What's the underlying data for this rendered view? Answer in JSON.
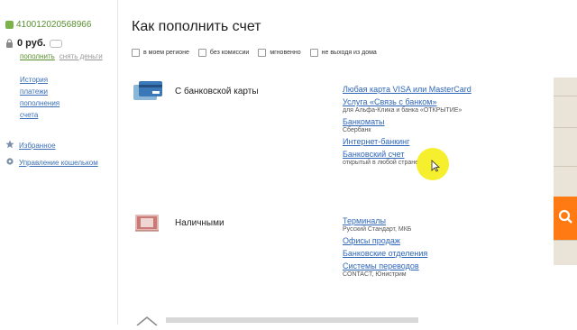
{
  "account": {
    "number": "410012020568966",
    "balance": "0 руб.",
    "top_up": "пополнить",
    "withdraw": "снять деньги"
  },
  "nav": {
    "history": "История",
    "payments": "платежи",
    "topups": "пополнения",
    "invoices": "счета",
    "favorites": "Избранное",
    "wallet": "Управление кошельком"
  },
  "main": {
    "title": "Как пополнить счет",
    "filters": [
      "в моем регионе",
      "без комиссии",
      "мгновенно",
      "не выходя из дома"
    ]
  },
  "methods": {
    "card": {
      "label": "С банковской карты",
      "options": [
        {
          "link": "Любая карта VISA или MasterCard",
          "sub": ""
        },
        {
          "link": "Услуга «Связь с банком»",
          "sub": "для Альфа-Клика и банка «ОТКРЫТИЕ»"
        },
        {
          "link": "Банкоматы",
          "sub": "Сбербанк"
        },
        {
          "link": "Интернет-банкинг",
          "sub": ""
        },
        {
          "link": "Банковский счет",
          "sub": "открытый в любой стране"
        }
      ]
    },
    "cash": {
      "label": "Наличными",
      "options": [
        {
          "link": "Терминалы",
          "sub": "Русский Стандарт, МКБ"
        },
        {
          "link": "Офисы продаж",
          "sub": ""
        },
        {
          "link": "Банковские отделения",
          "sub": ""
        },
        {
          "link": "Системы переводов",
          "sub": "CONTACT, Юнистрим"
        }
      ]
    }
  },
  "colors": {
    "link": "#2f67b8",
    "account_green": "#5a8f2f",
    "search_orange": "#ff7a12",
    "cursor_highlight": "#f4ee1c"
  }
}
